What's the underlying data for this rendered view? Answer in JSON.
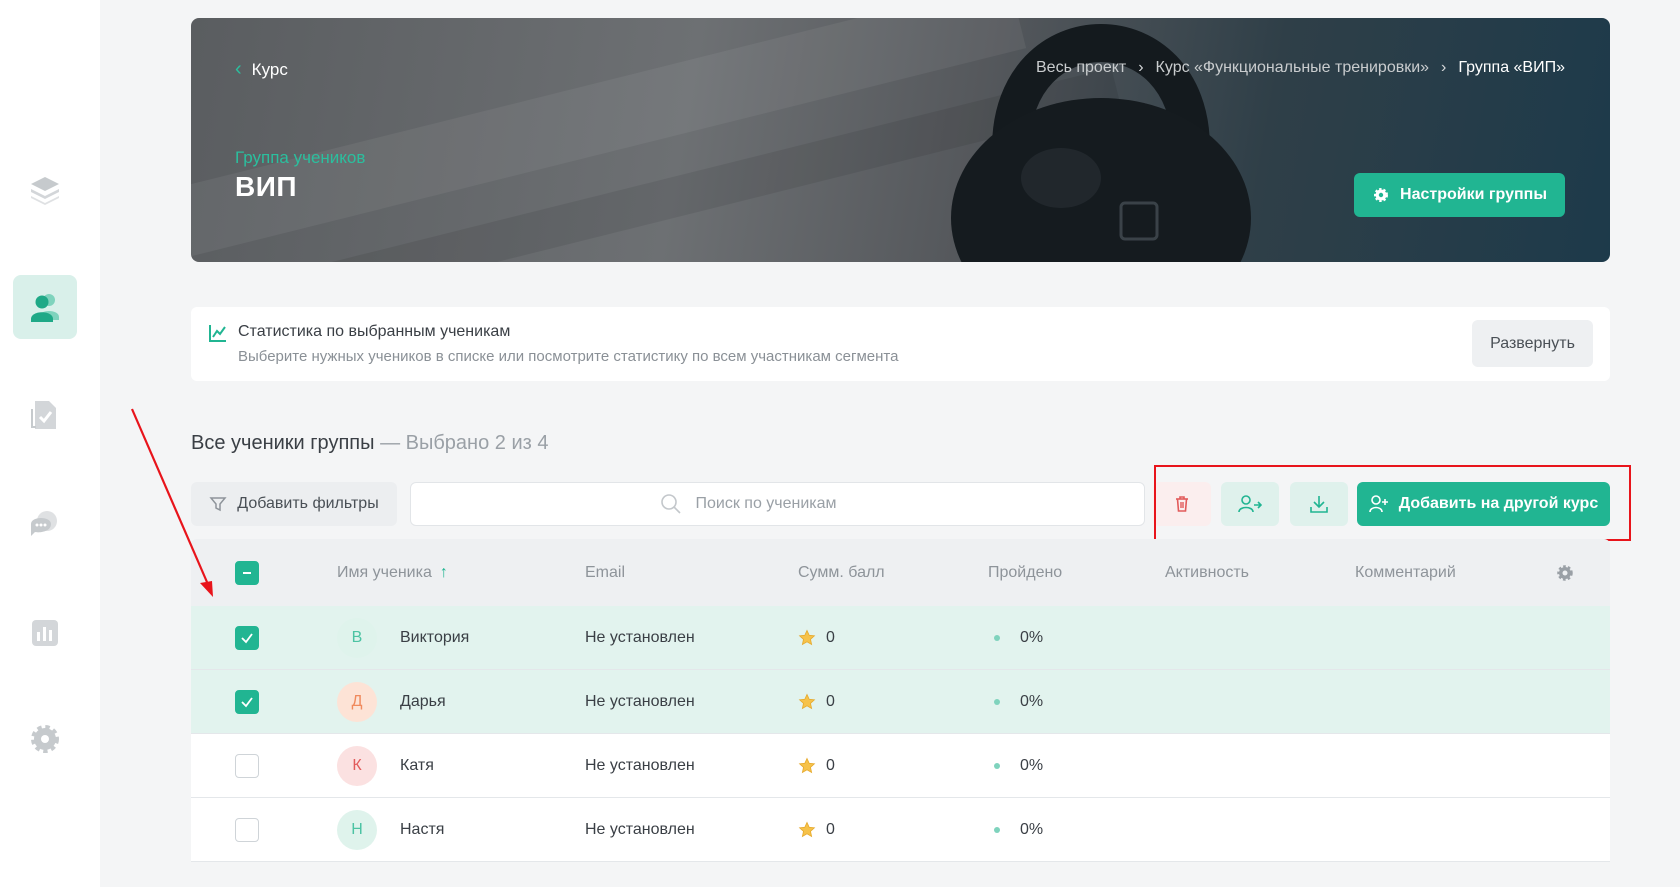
{
  "sidebar": {
    "items": [
      {
        "icon": "layers-icon"
      },
      {
        "icon": "users-icon",
        "active": true
      },
      {
        "icon": "document-check-icon"
      },
      {
        "icon": "chat-icon"
      },
      {
        "icon": "chart-icon"
      },
      {
        "icon": "gear-icon"
      }
    ]
  },
  "hero": {
    "back_label": "Курс",
    "breadcrumbs": [
      "Весь проект",
      "Курс «Функциональные тренировки»",
      "Группа «ВИП»"
    ],
    "subtitle": "Группа учеников",
    "title": "ВИП",
    "settings_label": "Настройки группы"
  },
  "stats": {
    "title": "Статистика по выбранным ученикам",
    "description": "Выберите нужных учеников в списке или посмотрите статистику по всем участникам сегмента",
    "expand_label": "Развернуть"
  },
  "section": {
    "title": "Все ученики группы",
    "selection": "— Выбрано 2 из 4"
  },
  "toolbar": {
    "filter_label": "Добавить фильтры",
    "search_placeholder": "Поиск по ученикам",
    "add_course_label": "Добавить на другой курс"
  },
  "table": {
    "columns": {
      "name": "Имя ученика",
      "email": "Email",
      "score": "Сумм. балл",
      "progress": "Пройдено",
      "activity": "Активность",
      "comment": "Комментарий"
    },
    "rows": [
      {
        "initial": "В",
        "name": "Виктория",
        "email": "Не установлен",
        "score": "0",
        "progress": "0%",
        "checked": true,
        "avatar_bg": "#dff3ec",
        "avatar_fg": "#4cc3a3"
      },
      {
        "initial": "Д",
        "name": "Дарья",
        "email": "Не установлен",
        "score": "0",
        "progress": "0%",
        "checked": true,
        "avatar_bg": "#fde3d6",
        "avatar_fg": "#f08a5d"
      },
      {
        "initial": "К",
        "name": "Катя",
        "email": "Не установлен",
        "score": "0",
        "progress": "0%",
        "checked": false,
        "avatar_bg": "#fbe1e1",
        "avatar_fg": "#e25b5b"
      },
      {
        "initial": "Н",
        "name": "Настя",
        "email": "Не установлен",
        "score": "0",
        "progress": "0%",
        "checked": false,
        "avatar_bg": "#dff3ec",
        "avatar_fg": "#4cc3a3"
      }
    ]
  },
  "colors": {
    "accent": "#21b592",
    "annotation": "#e8141b"
  }
}
